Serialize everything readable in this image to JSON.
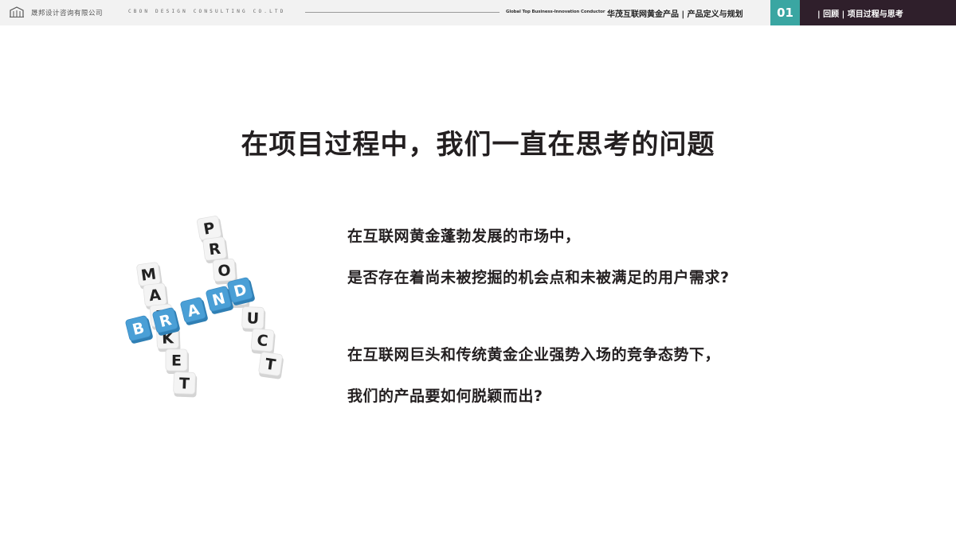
{
  "header": {
    "company_cn": "晟邦设计咨询有限公司",
    "company_en": "CBON DESIGN CONSULTING CO.LTD",
    "tagline": "Global Top Business-Innovation Conductor",
    "project_title": "华茂互联网黄金产品 | 产品定义与规划",
    "section_number": "01",
    "section_label": "| 回顾  | 项目过程与思考",
    "logo_icon": "building-logo-icon"
  },
  "main": {
    "title": "在项目过程中，我们一直在思考的问题",
    "paragraphs": [
      "在互联网黄金蓬勃发展的市场中，",
      "是否存在着尚未被挖掘的机会点和未被满足的用户需求?",
      "在互联网巨头和传统黄金企业强势入场的竞争态势下，",
      "我们的产品要如何脱颖而出?"
    ]
  },
  "illustration": {
    "word_market": [
      "M",
      "A",
      "R",
      "K",
      "E",
      "T"
    ],
    "word_brand": [
      "B",
      "R",
      "A",
      "N",
      "D"
    ],
    "word_product": [
      "P",
      "R",
      "O",
      "D",
      "U",
      "C",
      "T"
    ],
    "brand_color": "#4a9fd6",
    "cube_color": "#f4f4f4"
  },
  "colors": {
    "accent_teal": "#3aa6a2",
    "header_dark": "#2f1f2b",
    "text": "#231f20"
  }
}
